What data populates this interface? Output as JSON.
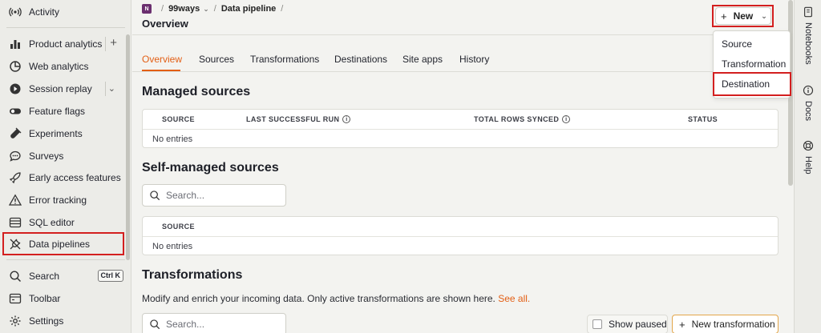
{
  "sidebar": {
    "items": [
      {
        "label": "Activity",
        "icon": "activity-icon"
      },
      {
        "label": "Product analytics",
        "icon": "bar-chart-icon",
        "extra": "+"
      },
      {
        "label": "Web analytics",
        "icon": "pie-chart-icon"
      },
      {
        "label": "Session replay",
        "icon": "play-icon",
        "extra": "⌄"
      },
      {
        "label": "Feature flags",
        "icon": "toggle-icon"
      },
      {
        "label": "Experiments",
        "icon": "flask-icon"
      },
      {
        "label": "Surveys",
        "icon": "chat-icon"
      },
      {
        "label": "Early access features",
        "icon": "rocket-icon"
      },
      {
        "label": "Error tracking",
        "icon": "warning-icon"
      },
      {
        "label": "SQL editor",
        "icon": "database-icon"
      },
      {
        "label": "Data pipelines",
        "icon": "plug-icon"
      },
      {
        "label": "Search",
        "icon": "search-icon",
        "kbd": "Ctrl K"
      },
      {
        "label": "Toolbar",
        "icon": "toolbar-icon"
      },
      {
        "label": "Settings",
        "icon": "gear-icon"
      }
    ]
  },
  "breadcrumb": {
    "project_badge": "N",
    "project": "99ways",
    "caret": "⌄",
    "section": "Data pipeline",
    "slash": "/"
  },
  "page_title": "Overview",
  "new_button": {
    "plus": "+",
    "label": "New",
    "caret": "⌄"
  },
  "tabs": [
    "Overview",
    "Sources",
    "Transformations",
    "Destinations",
    "Site apps",
    "History"
  ],
  "managed_sources": {
    "title": "Managed sources",
    "columns": [
      "SOURCE",
      "LAST SUCCESSFUL RUN",
      "TOTAL ROWS SYNCED",
      "STATUS"
    ],
    "empty": "No entries"
  },
  "self_managed": {
    "title": "Self-managed sources",
    "search_placeholder": "Search...",
    "columns": [
      "SOURCE"
    ],
    "empty": "No entries"
  },
  "transformations": {
    "title": "Transformations",
    "description": "Modify and enrich your incoming data. Only active transformations are shown here.",
    "see_all": "See all.",
    "search_placeholder": "Search...",
    "show_paused": "Show paused",
    "new_button_plus": "+",
    "new_button": "New transformation"
  },
  "dropdown": {
    "items": [
      "Source",
      "Transformation",
      "Destination"
    ]
  },
  "right_panel": {
    "items": [
      "Notebooks",
      "Docs",
      "Help"
    ]
  },
  "info_glyph": "i",
  "colors": {
    "accent": "#e35f15",
    "highlight": "#d31f1f"
  }
}
